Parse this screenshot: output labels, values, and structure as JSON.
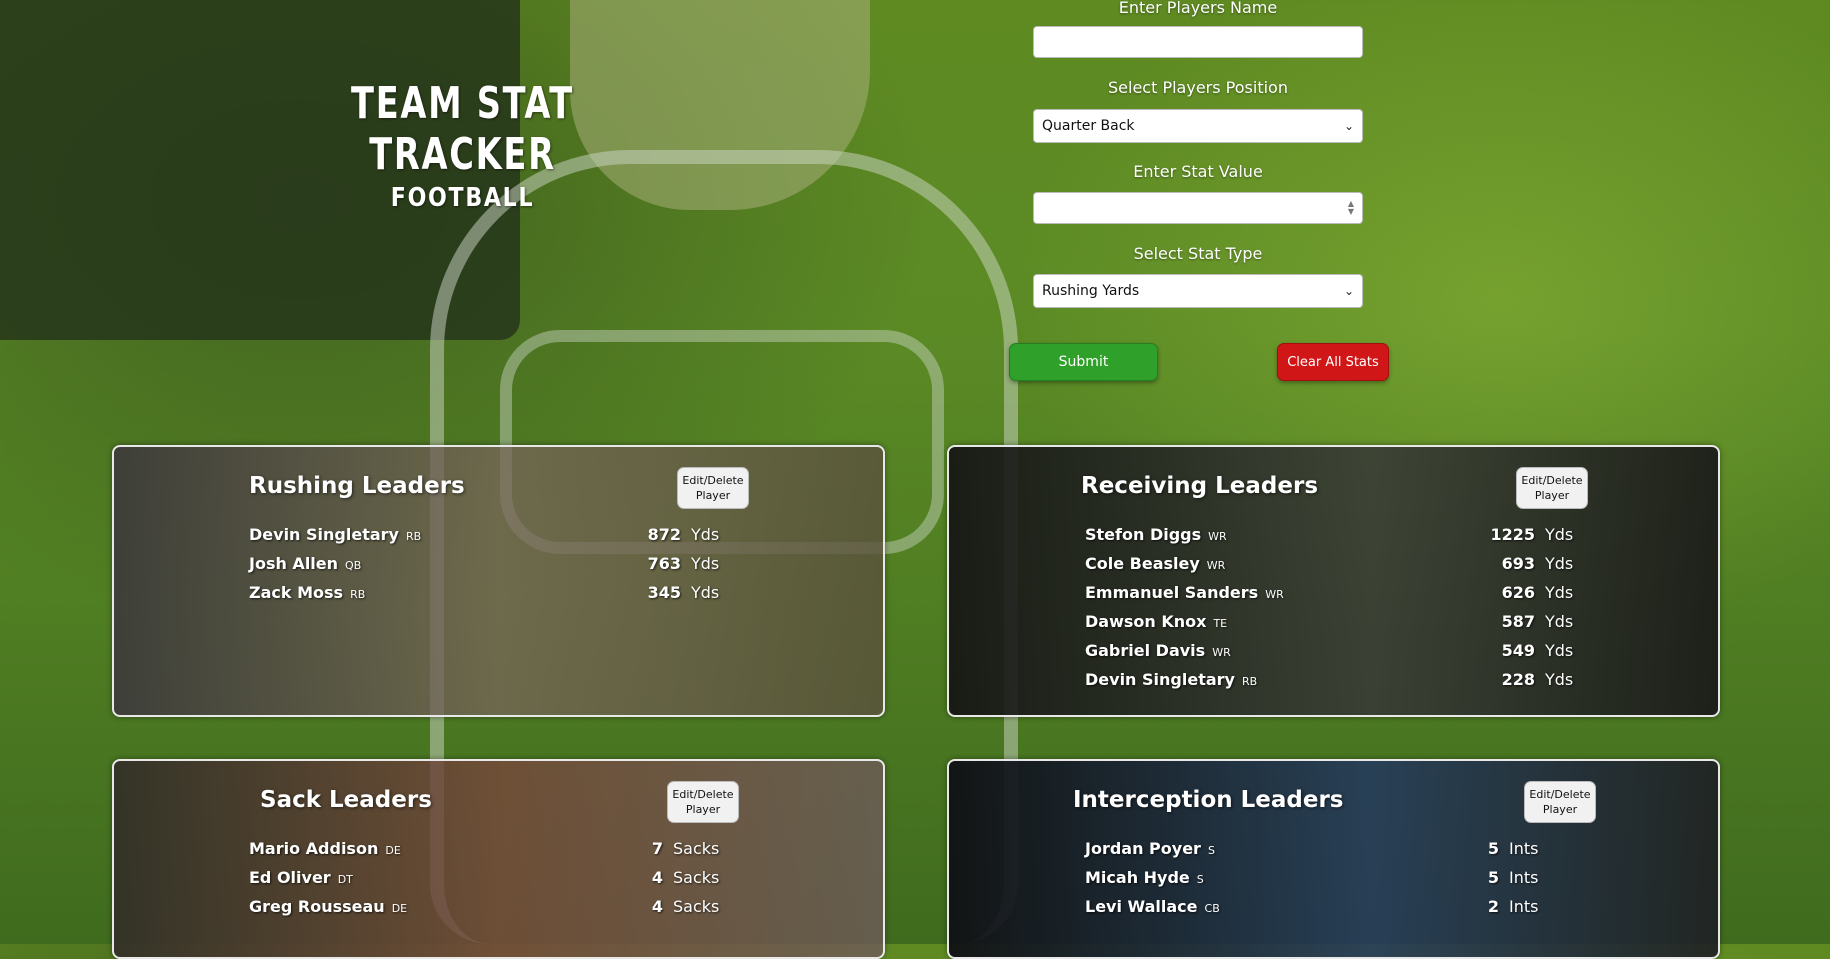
{
  "header": {
    "title": "TEAM STAT TRACKER",
    "subtitle": "FOOTBALL"
  },
  "form": {
    "name_label": "Enter Players Name",
    "name_value": "",
    "position_label": "Select Players Position",
    "position_selected": "Quarter Back",
    "stat_value_label": "Enter Stat Value",
    "stat_value": "",
    "stat_type_label": "Select Stat Type",
    "stat_type_selected": "Rushing Yards",
    "submit_label": "Submit",
    "clear_label": "Clear All Stats"
  },
  "cards": {
    "rushing": {
      "title": "Rushing Leaders",
      "edit_label": "Edit/Delete Player",
      "unit": "Yds",
      "players": [
        {
          "name": "Devin Singletary",
          "pos": "RB",
          "value": "872"
        },
        {
          "name": "Josh Allen",
          "pos": "QB",
          "value": "763"
        },
        {
          "name": "Zack Moss",
          "pos": "RB",
          "value": "345"
        }
      ]
    },
    "receiving": {
      "title": "Receiving Leaders",
      "edit_label": "Edit/Delete Player",
      "unit": "Yds",
      "players": [
        {
          "name": "Stefon Diggs",
          "pos": "WR",
          "value": "1225"
        },
        {
          "name": "Cole Beasley",
          "pos": "WR",
          "value": "693"
        },
        {
          "name": "Emmanuel Sanders",
          "pos": "WR",
          "value": "626"
        },
        {
          "name": "Dawson Knox",
          "pos": "TE",
          "value": "587"
        },
        {
          "name": "Gabriel Davis",
          "pos": "WR",
          "value": "549"
        },
        {
          "name": "Devin Singletary",
          "pos": "RB",
          "value": "228"
        }
      ]
    },
    "sacks": {
      "title": "Sack Leaders",
      "edit_label": "Edit/Delete Player",
      "unit": "Sacks",
      "players": [
        {
          "name": "Mario Addison",
          "pos": "DE",
          "value": "7"
        },
        {
          "name": "Ed Oliver",
          "pos": "DT",
          "value": "4"
        },
        {
          "name": "Greg Rousseau",
          "pos": "DE",
          "value": "4"
        }
      ]
    },
    "interceptions": {
      "title": "Interception Leaders",
      "edit_label": "Edit/Delete Player",
      "unit": "Ints",
      "players": [
        {
          "name": "Jordan Poyer",
          "pos": "S",
          "value": "5"
        },
        {
          "name": "Micah Hyde",
          "pos": "S",
          "value": "5"
        },
        {
          "name": "Levi Wallace",
          "pos": "CB",
          "value": "2"
        }
      ]
    }
  }
}
